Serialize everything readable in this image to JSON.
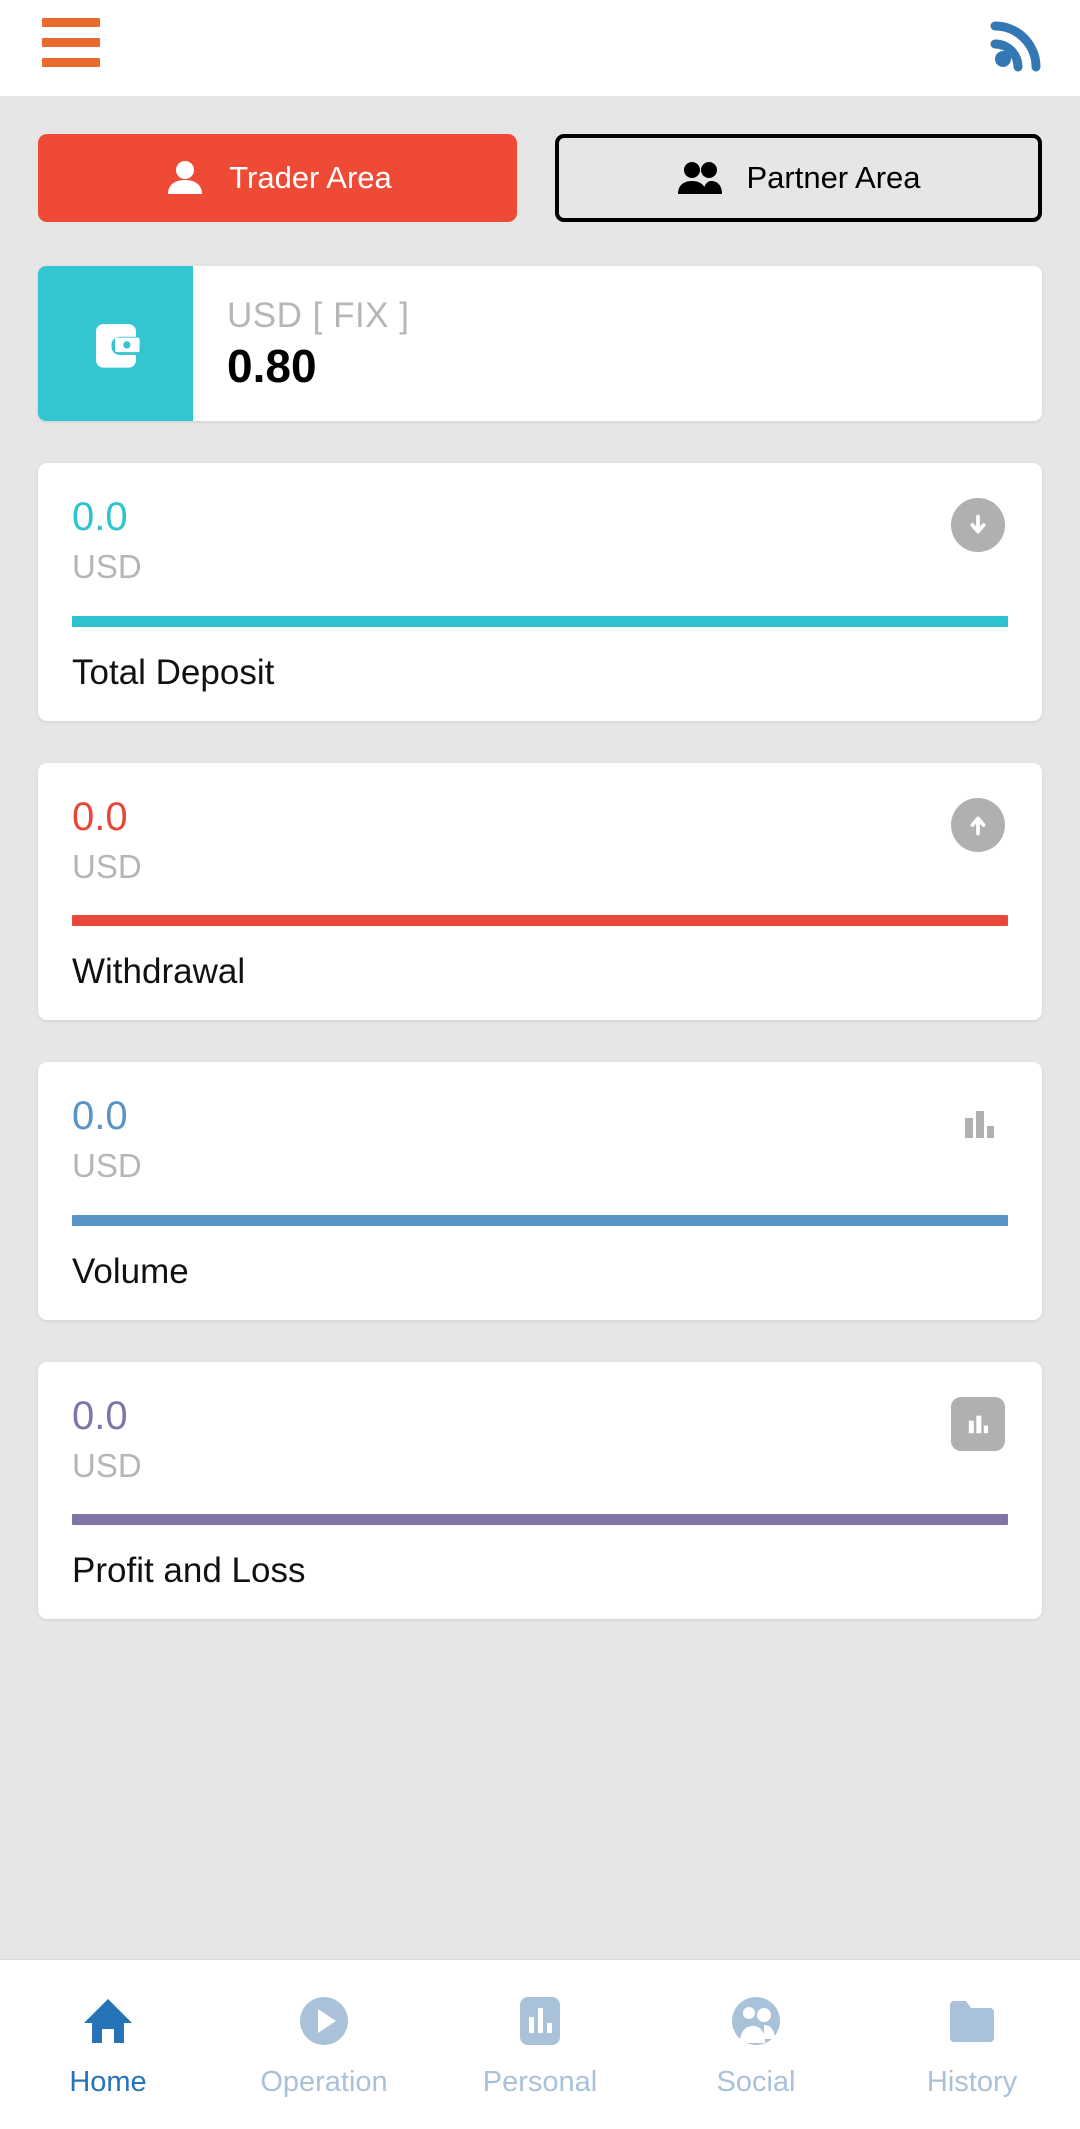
{
  "topbar": {
    "menu_icon": "hamburger-menu-icon",
    "signal_icon": "rss-signal-icon",
    "menu_color": "#ea6a2e",
    "signal_color": "#3477b5"
  },
  "area_toggle": {
    "buttons": [
      {
        "label": "Trader Area",
        "icon": "person-icon",
        "active": true,
        "bg": "#ef4a35",
        "text_color": "#ffffff"
      },
      {
        "label": "Partner Area",
        "icon": "people-icon",
        "active": false,
        "bg": "transparent",
        "text_color": "#000000"
      }
    ]
  },
  "balance": {
    "icon": "wallet-icon",
    "icon_bg": "#34c6d0",
    "currency": "USD [ FIX ]",
    "value": "0.80"
  },
  "metrics": [
    {
      "value": "0.0",
      "currency": "USD",
      "label": "Total Deposit",
      "color": "#2ec4cf",
      "icon": "arrow-down-circle-icon",
      "icon_style": "circle"
    },
    {
      "value": "0.0",
      "currency": "USD",
      "label": "Withdrawal",
      "color": "#e8483a",
      "icon": "arrow-up-circle-icon",
      "icon_style": "circle"
    },
    {
      "value": "0.0",
      "currency": "USD",
      "label": "Volume",
      "color": "#5a93ca",
      "icon": "bar-chart-icon",
      "icon_style": "plain"
    },
    {
      "value": "0.0",
      "currency": "USD",
      "label": "Profit and Loss",
      "color": "#8074a8",
      "icon": "bar-chart-square-icon",
      "icon_style": "square"
    }
  ],
  "bottom_nav": {
    "active_color": "#2674b8",
    "inactive_color": "#a9c2da",
    "items": [
      {
        "label": "Home",
        "icon": "home-icon",
        "active": true
      },
      {
        "label": "Operation",
        "icon": "play-circle-icon",
        "active": false
      },
      {
        "label": "Personal",
        "icon": "chart-square-icon",
        "active": false
      },
      {
        "label": "Social",
        "icon": "social-group-icon",
        "active": false
      },
      {
        "label": "History",
        "icon": "folder-icon",
        "active": false
      }
    ]
  }
}
